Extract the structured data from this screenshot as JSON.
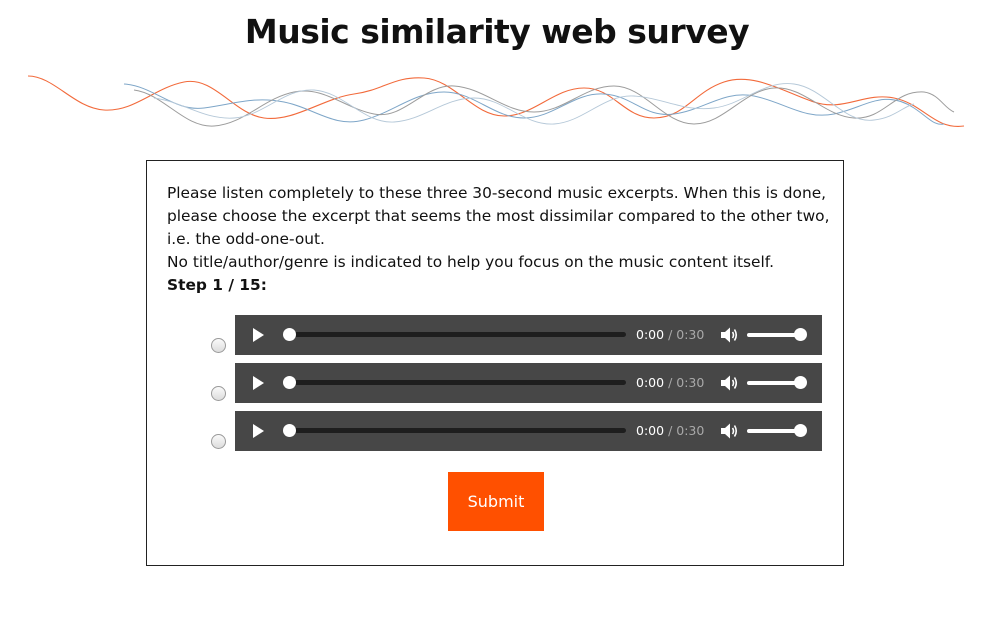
{
  "header": {
    "title": "Music similarity web survey"
  },
  "colors": {
    "accent": "#ff5000",
    "player_bg": "#474747",
    "wave_orange": "#f26a3b",
    "wave_blue": "#7ea6c8",
    "wave_gray": "#9c9c9c"
  },
  "survey": {
    "instruction_line1": "Please listen completely to these three 30-second music excerpts. When this is done, please choose the excerpt that seems the most dissimilar compared to the other two, i.e. the odd-one-out.",
    "instruction_line2": "No title/author/genre is indicated to help you focus on the music content itself.",
    "step_label": "Step 1 / 15:",
    "excerpts": [
      {
        "current_time": "0:00",
        "separator": "/",
        "duration": "0:30",
        "selected": false,
        "volume": 1.0,
        "progress": 0.0
      },
      {
        "current_time": "0:00",
        "separator": "/",
        "duration": "0:30",
        "selected": false,
        "volume": 1.0,
        "progress": 0.0
      },
      {
        "current_time": "0:00",
        "separator": "/",
        "duration": "0:30",
        "selected": false,
        "volume": 1.0,
        "progress": 0.0
      }
    ],
    "submit_label": "Submit"
  },
  "icons": {
    "play": "play-icon",
    "volume": "volume-icon",
    "decoration": "sound-wave-decoration"
  }
}
